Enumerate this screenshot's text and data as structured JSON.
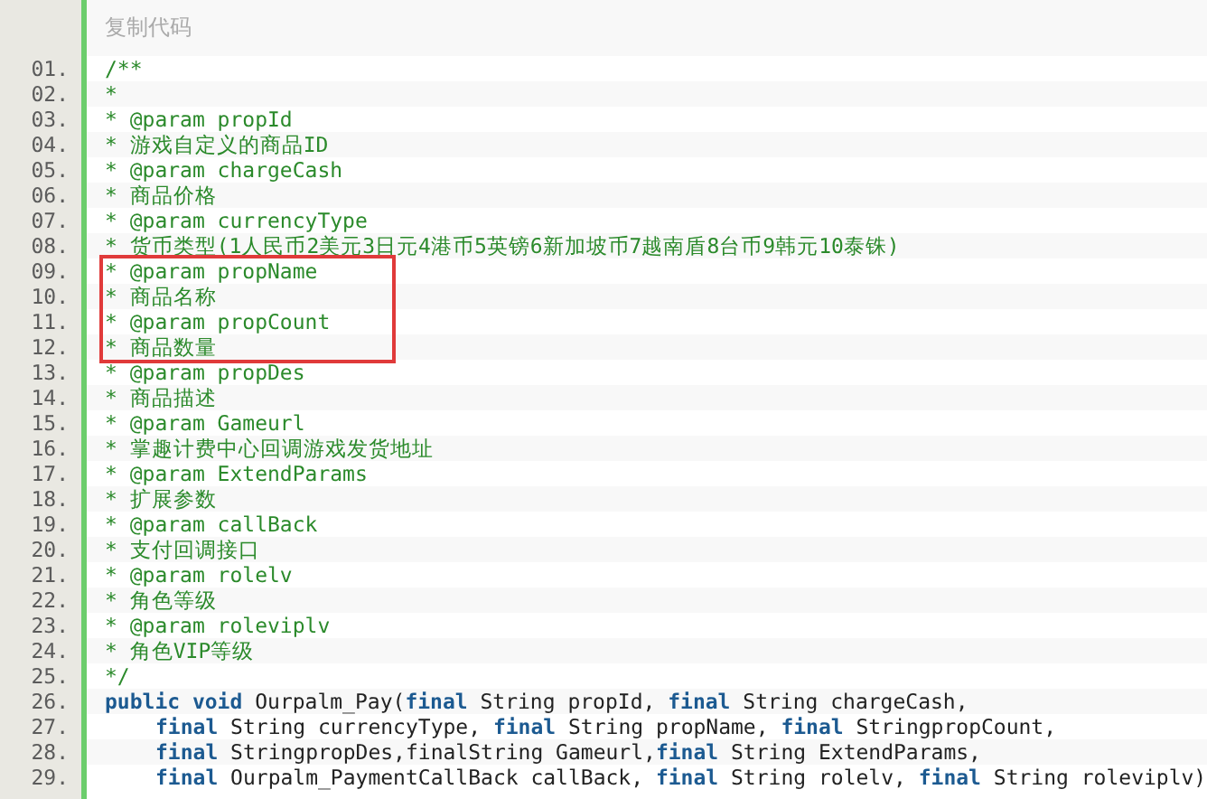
{
  "toolbar": {
    "copy_link": "复制代码"
  },
  "lines": [
    {
      "number": "01.",
      "kind": "comment",
      "text": "/**",
      "boxed": false
    },
    {
      "number": "02.",
      "kind": "comment",
      "text": "*",
      "boxed": false
    },
    {
      "number": "03.",
      "kind": "comment",
      "text": "* @param propId",
      "boxed": false
    },
    {
      "number": "04.",
      "kind": "comment",
      "text": "* 游戏自定义的商品ID",
      "boxed": false
    },
    {
      "number": "05.",
      "kind": "comment",
      "text": "* @param chargeCash",
      "boxed": false
    },
    {
      "number": "06.",
      "kind": "comment",
      "text": "* 商品价格",
      "boxed": false
    },
    {
      "number": "07.",
      "kind": "comment",
      "text": "* @param currencyType",
      "boxed": false
    },
    {
      "number": "08.",
      "kind": "comment",
      "text": "* 货币类型(1人民币2美元3日元4港币5英镑6新加坡币7越南盾8台币9韩元10泰铢)",
      "boxed": false
    },
    {
      "number": "09.",
      "kind": "comment",
      "text": "* @param propName",
      "boxed": true
    },
    {
      "number": "10.",
      "kind": "comment",
      "text": "* 商品名称",
      "boxed": true
    },
    {
      "number": "11.",
      "kind": "comment",
      "text": "* @param propCount",
      "boxed": true
    },
    {
      "number": "12.",
      "kind": "comment",
      "text": "* 商品数量",
      "boxed": true
    },
    {
      "number": "13.",
      "kind": "comment",
      "text": "* @param propDes",
      "boxed": false
    },
    {
      "number": "14.",
      "kind": "comment",
      "text": "* 商品描述",
      "boxed": false
    },
    {
      "number": "15.",
      "kind": "comment",
      "text": "* @param Gameurl",
      "boxed": false
    },
    {
      "number": "16.",
      "kind": "comment",
      "text": "* 掌趣计费中心回调游戏发货地址",
      "boxed": false
    },
    {
      "number": "17.",
      "kind": "comment",
      "text": "* @param ExtendParams",
      "boxed": false
    },
    {
      "number": "18.",
      "kind": "comment",
      "text": "* 扩展参数",
      "boxed": false
    },
    {
      "number": "19.",
      "kind": "comment",
      "text": "* @param callBack",
      "boxed": false
    },
    {
      "number": "20.",
      "kind": "comment",
      "text": "* 支付回调接口",
      "boxed": false
    },
    {
      "number": "21.",
      "kind": "comment",
      "text": "* @param rolelv",
      "boxed": false
    },
    {
      "number": "22.",
      "kind": "comment",
      "text": "* 角色等级",
      "boxed": false
    },
    {
      "number": "23.",
      "kind": "comment",
      "text": "* @param roleviplv",
      "boxed": false
    },
    {
      "number": "24.",
      "kind": "comment",
      "text": "* 角色VIP等级",
      "boxed": false
    },
    {
      "number": "25.",
      "kind": "comment",
      "text": "*/",
      "boxed": false
    },
    {
      "number": "26.",
      "kind": "code",
      "boxed": false,
      "indented": false,
      "tokens": [
        {
          "kind": "keyword",
          "text": "public void"
        },
        {
          "kind": "plain",
          "text": " Ourpalm_Pay("
        },
        {
          "kind": "keyword",
          "text": "final"
        },
        {
          "kind": "plain",
          "text": " String propId, "
        },
        {
          "kind": "keyword",
          "text": "final"
        },
        {
          "kind": "plain",
          "text": " String chargeCash,"
        }
      ]
    },
    {
      "number": "27.",
      "kind": "code",
      "boxed": false,
      "indented": true,
      "tokens": [
        {
          "kind": "keyword",
          "text": "final"
        },
        {
          "kind": "plain",
          "text": " String currencyType, "
        },
        {
          "kind": "keyword",
          "text": "final"
        },
        {
          "kind": "plain",
          "text": " String propName, "
        },
        {
          "kind": "keyword",
          "text": "final"
        },
        {
          "kind": "plain",
          "text": " StringpropCount,"
        }
      ]
    },
    {
      "number": "28.",
      "kind": "code",
      "boxed": false,
      "indented": true,
      "tokens": [
        {
          "kind": "keyword",
          "text": "final"
        },
        {
          "kind": "plain",
          "text": " StringpropDes,finalString Gameurl,"
        },
        {
          "kind": "keyword",
          "text": "final"
        },
        {
          "kind": "plain",
          "text": " String ExtendParams,"
        }
      ]
    },
    {
      "number": "29.",
      "kind": "code",
      "boxed": false,
      "indented": true,
      "tokens": [
        {
          "kind": "keyword",
          "text": "final"
        },
        {
          "kind": "plain",
          "text": " Ourpalm_PaymentCallBack callBack, "
        },
        {
          "kind": "keyword",
          "text": "final"
        },
        {
          "kind": "plain",
          "text": " String rolelv, "
        },
        {
          "kind": "keyword",
          "text": "final"
        },
        {
          "kind": "plain",
          "text": " String roleviplv)"
        }
      ]
    }
  ]
}
